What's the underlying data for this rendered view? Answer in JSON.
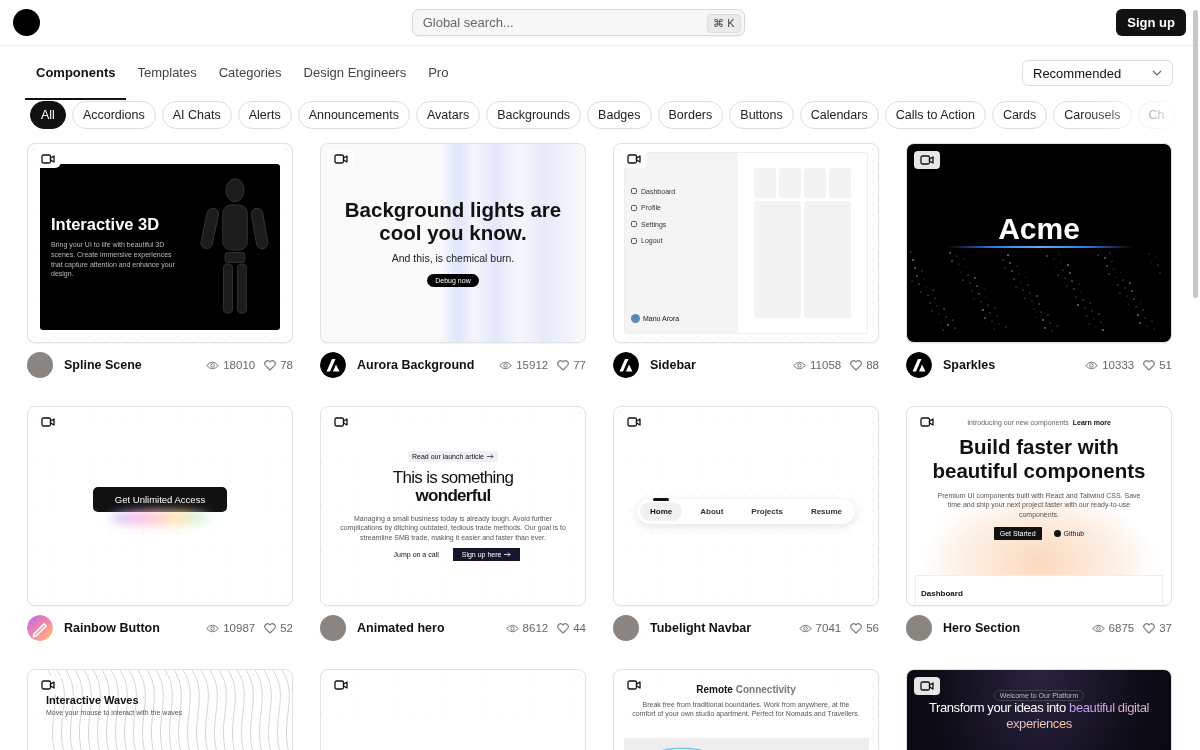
{
  "header": {
    "search": {
      "placeholder": "Global search...",
      "shortcut": "⌘ K"
    },
    "signup": "Sign up"
  },
  "tabs": [
    {
      "label": "Components",
      "selected": true
    },
    {
      "label": "Templates",
      "selected": false
    },
    {
      "label": "Categories",
      "selected": false
    },
    {
      "label": "Design Engineers",
      "selected": false
    },
    {
      "label": "Pro",
      "selected": false
    }
  ],
  "sort": {
    "value": "Recommended"
  },
  "chips": [
    {
      "label": "All",
      "selected": true
    },
    {
      "label": "Accordions",
      "selected": false
    },
    {
      "label": "AI Chats",
      "selected": false
    },
    {
      "label": "Alerts",
      "selected": false
    },
    {
      "label": "Announcements",
      "selected": false
    },
    {
      "label": "Avatars",
      "selected": false
    },
    {
      "label": "Backgrounds",
      "selected": false
    },
    {
      "label": "Badges",
      "selected": false
    },
    {
      "label": "Borders",
      "selected": false
    },
    {
      "label": "Buttons",
      "selected": false
    },
    {
      "label": "Calendars",
      "selected": false
    },
    {
      "label": "Calls to Action",
      "selected": false
    },
    {
      "label": "Cards",
      "selected": false
    },
    {
      "label": "Carousels",
      "selected": false
    },
    {
      "label": "Ch",
      "selected": false
    }
  ],
  "cards": [
    {
      "name": "Spline Scene",
      "views": "18010",
      "likes": "78",
      "avatar": {
        "kind": "photo"
      },
      "preview": {
        "kind": "spline",
        "title": "Interactive 3D",
        "text": "Bring your UI to life with beautiful 3D scenes. Create immersive experiences that capture attention and enhance your design."
      }
    },
    {
      "name": "Aurora Background",
      "views": "15912",
      "likes": "77",
      "avatar": {
        "kind": "logo"
      },
      "preview": {
        "kind": "aurora",
        "title": "Background lights are cool you know.",
        "text": "And this, is chemical burn.",
        "button": "Debug now"
      }
    },
    {
      "name": "Sidebar",
      "views": "11058",
      "likes": "88",
      "avatar": {
        "kind": "logo"
      },
      "preview": {
        "kind": "sidebar",
        "items": [
          "Dashboard",
          "Profile",
          "Settings",
          "Logout"
        ],
        "user": "Manu Arora"
      }
    },
    {
      "name": "Sparkles",
      "views": "10333",
      "likes": "51",
      "avatar": {
        "kind": "logo"
      },
      "preview": {
        "kind": "sparkles",
        "title": "Acme"
      }
    },
    {
      "name": "Rainbow Button",
      "views": "10987",
      "likes": "52",
      "avatar": {
        "kind": "gradient"
      },
      "preview": {
        "kind": "rainbow",
        "button": "Get Unlimited Access"
      }
    },
    {
      "name": "Animated hero",
      "views": "8612",
      "likes": "44",
      "avatar": {
        "kind": "photo"
      },
      "preview": {
        "kind": "hero",
        "badge": "Read our launch article",
        "title": "This is something",
        "title_bold": "wonderful",
        "text": "Managing a small business today is already tough. Avoid further complications by ditching outdated, tedious trade methods. Our goal is to streamline SMB trade, making it easier and faster than ever.",
        "secondary": "Jump on a call",
        "primary": "Sign up here"
      }
    },
    {
      "name": "Tubelight Navbar",
      "views": "7041",
      "likes": "56",
      "avatar": {
        "kind": "photo"
      },
      "preview": {
        "kind": "navbar",
        "items": [
          {
            "label": "Home",
            "selected": true
          },
          {
            "label": "About",
            "selected": false
          },
          {
            "label": "Projects",
            "selected": false
          },
          {
            "label": "Resume",
            "selected": false
          }
        ]
      }
    },
    {
      "name": "Hero Section",
      "views": "6875",
      "likes": "37",
      "avatar": {
        "kind": "photo"
      },
      "preview": {
        "kind": "herosection",
        "badge": "Introducing our new components",
        "link": "Learn more",
        "title": "Build faster with beautiful components",
        "text": "Premium UI components built with React and Tailwind CSS. Save time and ship your next project faster with our ready-to-use components.",
        "primary": "Get Started",
        "secondary": "Github",
        "dash_title": "Dashboard"
      }
    },
    {
      "preview": {
        "kind": "waves",
        "title": "Interactive Waves",
        "text": "Move your mouse to interact with the waves"
      }
    },
    {
      "preview": {
        "kind": "empty"
      }
    },
    {
      "preview": {
        "kind": "remote",
        "title": "Remote",
        "title_muted": "Connectivity",
        "text": "Break free from traditional boundaries. Work from anywhere, at the comfort of your own studio apartment. Perfect for Nomads and Travellers."
      }
    },
    {
      "preview": {
        "kind": "darkhero",
        "badge": "Welcome to Our Platform",
        "title": "Transform your ideas into",
        "title_accent": "beautiful digital experiences"
      }
    }
  ]
}
